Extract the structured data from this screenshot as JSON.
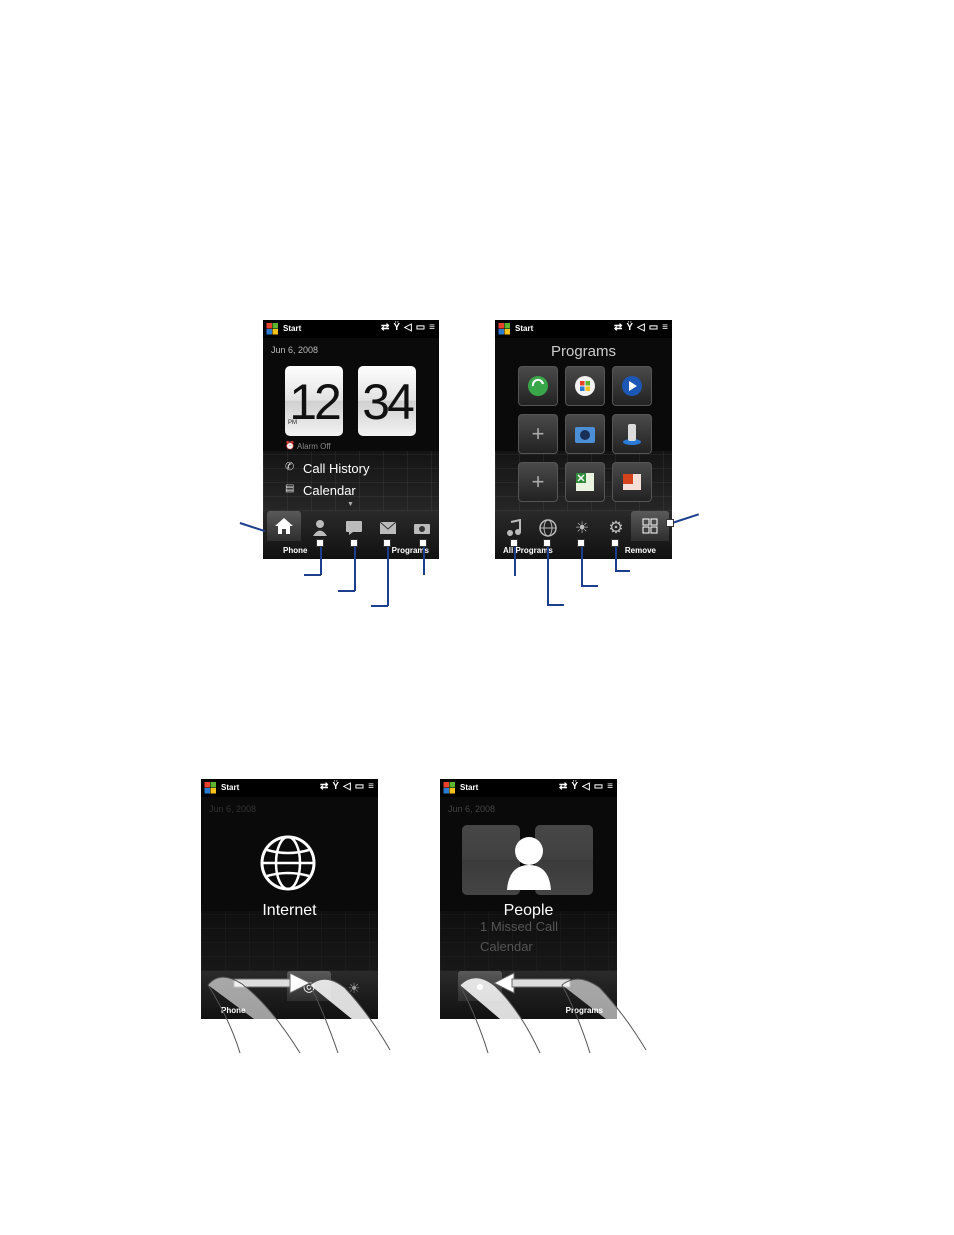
{
  "status": {
    "start_label": "Start"
  },
  "home": {
    "date": "Jun 6, 2008",
    "hour": "12",
    "minute": "34",
    "ampm": "PM",
    "alarm": "Alarm Off",
    "menu": [
      "Call History",
      "Calendar"
    ],
    "left_label": "Phone",
    "right_label": "Programs"
  },
  "programs": {
    "title": "Programs",
    "left_label": "All Programs",
    "right_label": "Remove"
  },
  "internet": {
    "date": "Jun 6, 2008",
    "overlay": "Internet",
    "left_label": "Phone"
  },
  "people": {
    "date": "Jun 6, 2008",
    "overlay": "People",
    "menu": [
      "1 Missed Call",
      "Calendar"
    ],
    "right_label": "Programs"
  },
  "colors": {
    "callout": "#1c3e8f"
  }
}
